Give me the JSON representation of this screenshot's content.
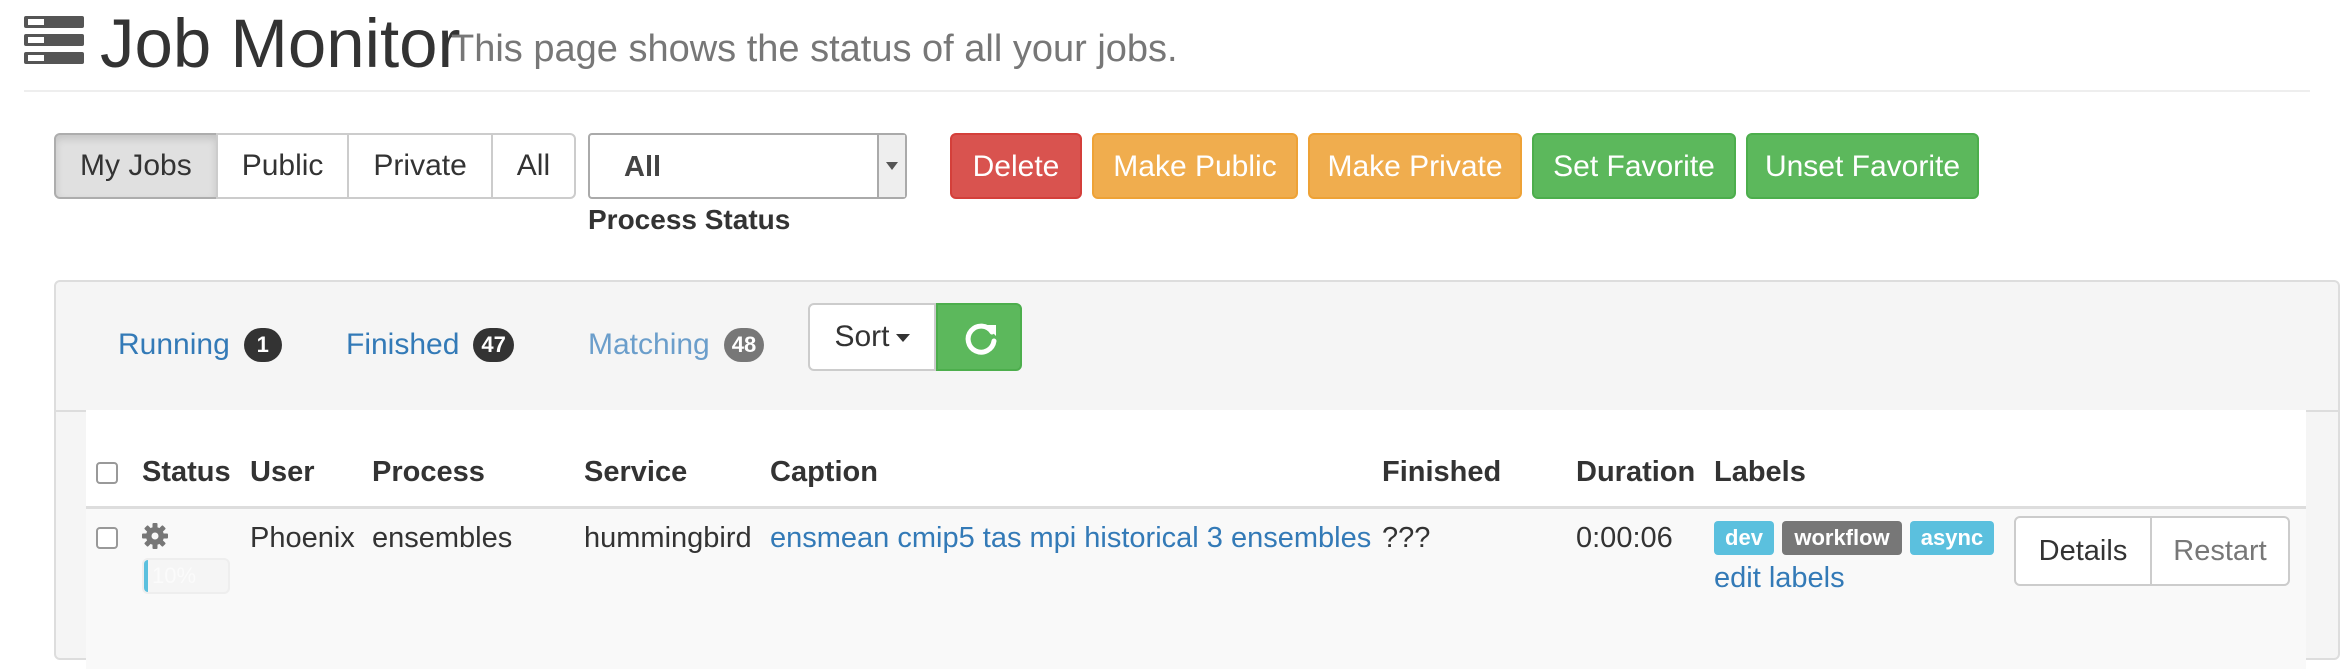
{
  "header": {
    "title": "Job Monitor",
    "subtitle": "This page shows the status of all your jobs.",
    "icon": "tasks-icon"
  },
  "filters": {
    "access_buttons": [
      {
        "label": "My Jobs",
        "active": true
      },
      {
        "label": "Public",
        "active": false
      },
      {
        "label": "Private",
        "active": false
      },
      {
        "label": "All",
        "active": false
      }
    ],
    "process_status": {
      "selected": "All",
      "label": "Process Status"
    }
  },
  "actions": {
    "delete": "Delete",
    "make_public": "Make Public",
    "make_private": "Make Private",
    "set_favorite": "Set Favorite",
    "unset_favorite": "Unset Favorite"
  },
  "toolbar": {
    "running": {
      "label": "Running",
      "count": "1"
    },
    "finished": {
      "label": "Finished",
      "count": "47"
    },
    "matching": {
      "label": "Matching",
      "count": "48"
    },
    "sort_label": "Sort",
    "refresh_icon": "refresh-icon"
  },
  "table": {
    "columns": {
      "status": "Status",
      "user": "User",
      "process": "Process",
      "service": "Service",
      "caption": "Caption",
      "finished": "Finished",
      "duration": "Duration",
      "labels": "Labels"
    },
    "rows": [
      {
        "status_icon": "gear-icon",
        "progress_text": "10%",
        "progress_fraction": 0.05,
        "user": "Phoenix",
        "process": "ensembles",
        "service": "hummingbird",
        "caption": "ensmean cmip5 tas mpi historical 3 ensembles",
        "finished": "???",
        "duration": "0:00:06",
        "labels": [
          "dev",
          "workflow",
          "async"
        ],
        "edit_labels": "edit labels",
        "details_label": "Details",
        "restart_label": "Restart"
      }
    ]
  },
  "colors": {
    "danger": "#d9534f",
    "warning": "#f0ad4e",
    "success": "#5cb85c",
    "info": "#5bc0de",
    "link": "#337ab7"
  }
}
